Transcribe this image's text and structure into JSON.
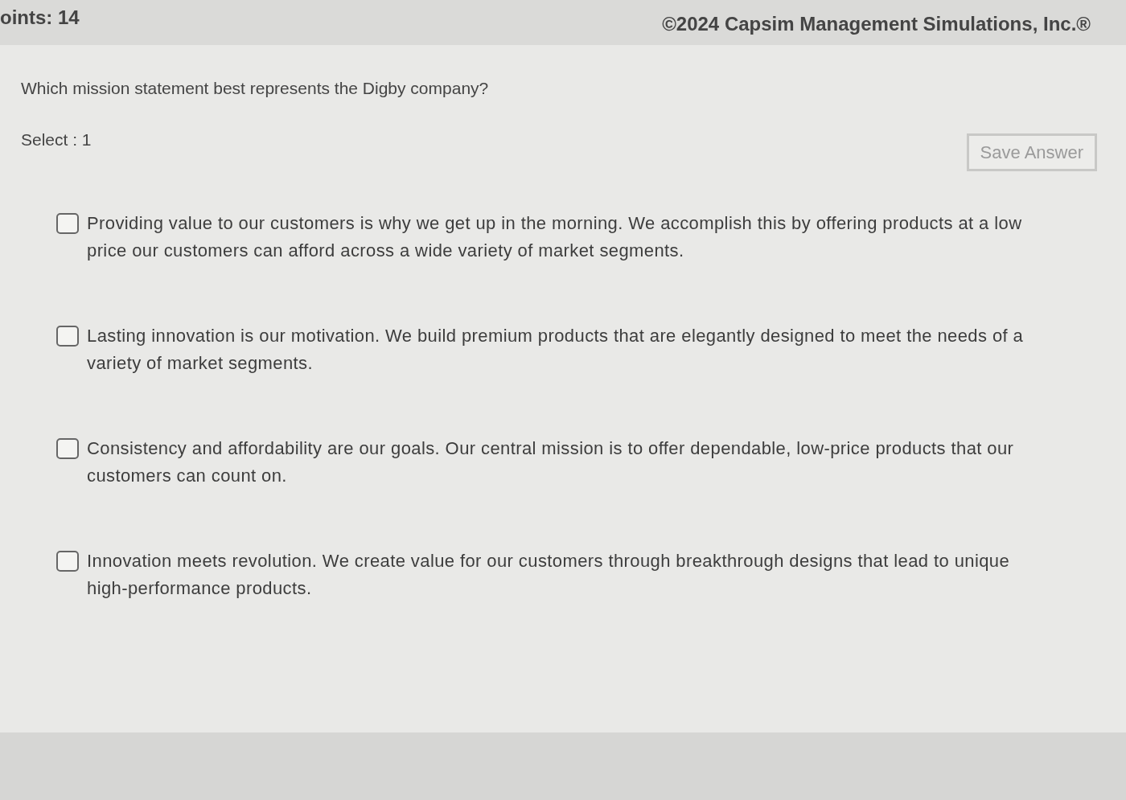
{
  "header": {
    "points": "oints: 14",
    "copyright": "©2024 Capsim Management Simulations, Inc.®"
  },
  "question": "Which mission statement best represents the Digby company?",
  "select_label": "Select : 1",
  "save_button": {
    "label": "Save Answer",
    "disabled": true
  },
  "options": [
    {
      "text": "Providing value to our customers is why we get up in the morning. We accomplish this by offering products at a low price our customers can afford across a wide variety of market segments.",
      "checked": false
    },
    {
      "text": "Lasting innovation is our motivation. We build premium products that are elegantly designed to meet the needs of a variety of market segments.",
      "checked": false
    },
    {
      "text": "Consistency and affordability are our goals. Our central mission is to offer dependable, low-price products that our customers can count on.",
      "checked": false
    },
    {
      "text": "Innovation meets revolution. We create value for our customers through breakthrough designs that lead to unique high-performance products.",
      "checked": false
    }
  ]
}
